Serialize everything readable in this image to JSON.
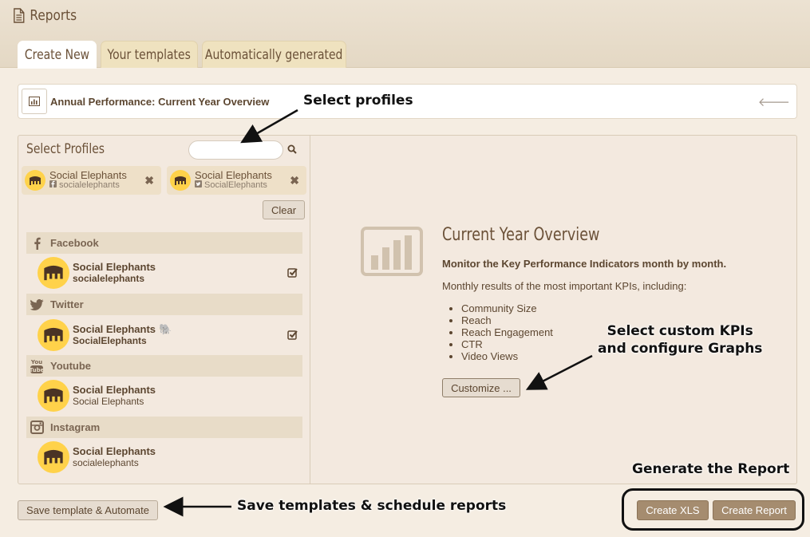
{
  "app": {
    "title": "Reports",
    "icon": "document-icon"
  },
  "tabs": [
    {
      "label": "Create New",
      "active": true
    },
    {
      "label": "Your templates",
      "active": false
    },
    {
      "label": "Automatically generated",
      "active": false
    }
  ],
  "report": {
    "name": "Annual Performance: Current Year Overview",
    "icon": "bar-chart-icon",
    "back_icon": "arrow-left-icon"
  },
  "profiles_panel": {
    "title": "Select Profiles",
    "search": {
      "value": "",
      "placeholder": ""
    },
    "selected_chips": [
      {
        "name": "Social Elephants",
        "handle": "socialelephants",
        "network_icon": "facebook-icon"
      },
      {
        "name": "Social Elephants",
        "handle": "SocialElephants",
        "network_icon": "twitter-icon"
      }
    ],
    "clear_label": "Clear",
    "networks": [
      {
        "label": "Facebook",
        "icon": "facebook-icon",
        "profile": {
          "name": "Social Elephants",
          "handle": "socialelephants",
          "checked": true
        }
      },
      {
        "label": "Twitter",
        "icon": "twitter-icon",
        "profile": {
          "name": "Social Elephants",
          "handle": "SocialElephants",
          "checked": true,
          "emoji": "🐘"
        }
      },
      {
        "label": "Youtube",
        "icon": "youtube-icon",
        "profile": {
          "name": "Social Elephants",
          "handle": "Social Elephants",
          "checked": false
        }
      },
      {
        "label": "Instagram",
        "icon": "instagram-icon",
        "profile": {
          "name": "Social Elephants",
          "handle": "socialelephants",
          "checked": false
        }
      }
    ]
  },
  "overview": {
    "title": "Current Year Overview",
    "subtitle": "Monitor the Key Performance Indicators month by month.",
    "description": "Monthly results of the most important KPIs, including:",
    "kpis": [
      "Community Size",
      "Reach",
      "Reach Engagement",
      "CTR",
      "Video Views"
    ],
    "customize_label": "Customize ..."
  },
  "footer": {
    "save_label": "Save template & Automate",
    "xls_label": "Create XLS",
    "report_label": "Create Report"
  },
  "annotations": {
    "select_profiles": "Select profiles",
    "kpis_line1": "Select custom KPIs",
    "kpis_line2": "and configure Graphs",
    "generate": "Generate the Report",
    "save": "Save templates & schedule reports"
  },
  "colors": {
    "accent": "#a58c6f",
    "avatar": "#ffd24a",
    "header": "#e8dcc8",
    "panel": "#f3e9df"
  }
}
